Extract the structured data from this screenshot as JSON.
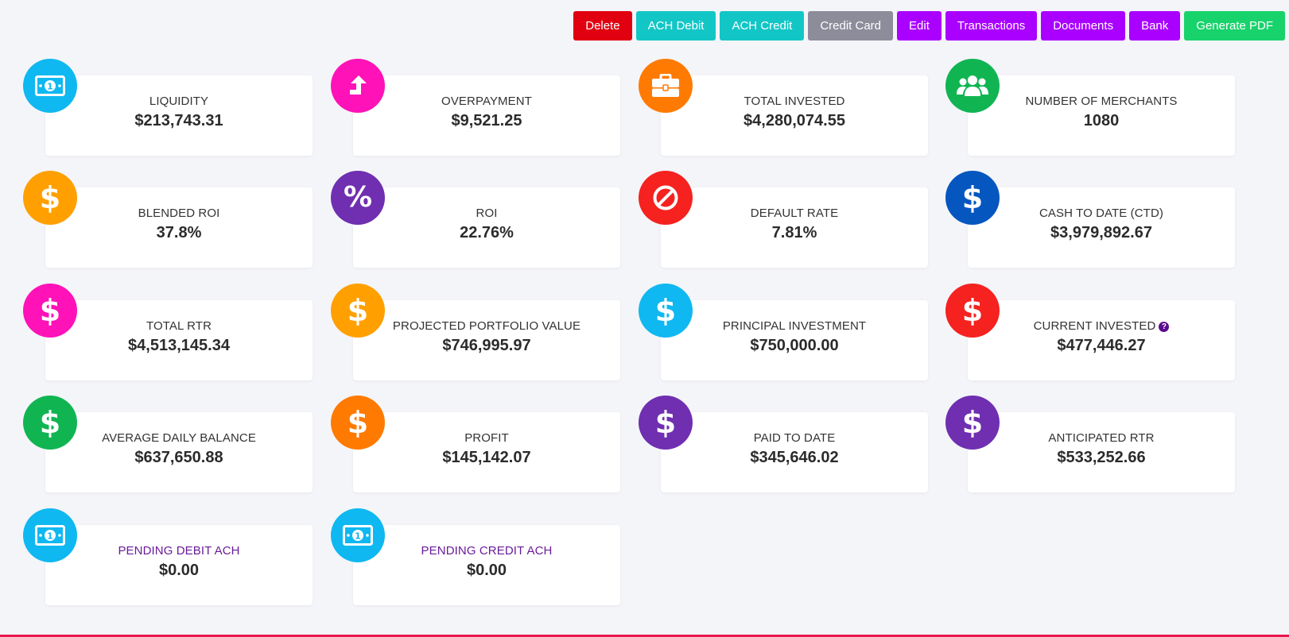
{
  "toolbar": {
    "buttons": [
      {
        "label": "Delete",
        "color": "#e00010"
      },
      {
        "label": "ACH Debit",
        "color": "#13c6c6"
      },
      {
        "label": "ACH Credit",
        "color": "#13c6c6"
      },
      {
        "label": "Credit Card",
        "color": "#8c8c9a"
      },
      {
        "label": "Edit",
        "color": "#aa00ff"
      },
      {
        "label": "Transactions",
        "color": "#aa00ff"
      },
      {
        "label": "Documents",
        "color": "#aa00ff"
      },
      {
        "label": "Bank",
        "color": "#aa00ff"
      },
      {
        "label": "Generate PDF",
        "color": "#18d36b"
      }
    ]
  },
  "cards": [
    {
      "label": "LIQUIDITY",
      "value": "$213,743.31",
      "icon": "money-bill-icon",
      "color": "#0fb8f0"
    },
    {
      "label": "OVERPAYMENT",
      "value": "$9,521.25",
      "icon": "arrow-up-icon",
      "color": "#ff12b8"
    },
    {
      "label": "TOTAL INVESTED",
      "value": "$4,280,074.55",
      "icon": "briefcase-icon",
      "color": "#ff7a00"
    },
    {
      "label": "NUMBER OF MERCHANTS",
      "value": "1080",
      "icon": "users-icon",
      "color": "#10b552"
    },
    {
      "label": "BLENDED ROI",
      "value": "37.8%",
      "icon": "dollar-icon",
      "color": "#ffa000"
    },
    {
      "label": "ROI",
      "value": "22.76%",
      "icon": "percent-icon",
      "color": "#6f2fb0"
    },
    {
      "label": "DEFAULT RATE",
      "value": "7.81%",
      "icon": "ban-icon",
      "color": "#f5221f"
    },
    {
      "label": "CASH TO DATE (CTD)",
      "value": "$3,979,892.67",
      "icon": "dollar-icon",
      "color": "#0656c0"
    },
    {
      "label": "TOTAL RTR",
      "value": "$4,513,145.34",
      "icon": "dollar-icon",
      "color": "#ff12b8"
    },
    {
      "label": "PROJECTED PORTFOLIO VALUE",
      "value": "$746,995.97",
      "icon": "dollar-icon",
      "color": "#ffa000"
    },
    {
      "label": "PRINCIPAL INVESTMENT",
      "value": "$750,000.00",
      "icon": "dollar-icon",
      "color": "#0fb8f0"
    },
    {
      "label": "CURRENT INVESTED",
      "value": "$477,446.27",
      "icon": "dollar-icon",
      "color": "#f5221f",
      "help": "?"
    },
    {
      "label": "AVERAGE DAILY BALANCE",
      "value": "$637,650.88",
      "icon": "dollar-icon",
      "color": "#10b552"
    },
    {
      "label": "PROFIT",
      "value": "$145,142.07",
      "icon": "dollar-icon",
      "color": "#ff7a00"
    },
    {
      "label": "PAID TO DATE",
      "value": "$345,646.02",
      "icon": "dollar-icon",
      "color": "#6f2fb0"
    },
    {
      "label": "ANTICIPATED RTR",
      "value": "$533,252.66",
      "icon": "dollar-icon",
      "color": "#6f2fb0"
    },
    {
      "label": "PENDING DEBIT ACH",
      "value": "$0.00",
      "icon": "money-bill-icon",
      "color": "#0fb8f0",
      "label_color": "#6a1b9a"
    },
    {
      "label": "PENDING CREDIT ACH",
      "value": "$0.00",
      "icon": "money-bill-icon",
      "color": "#0fb8f0",
      "label_color": "#6a1b9a"
    }
  ]
}
